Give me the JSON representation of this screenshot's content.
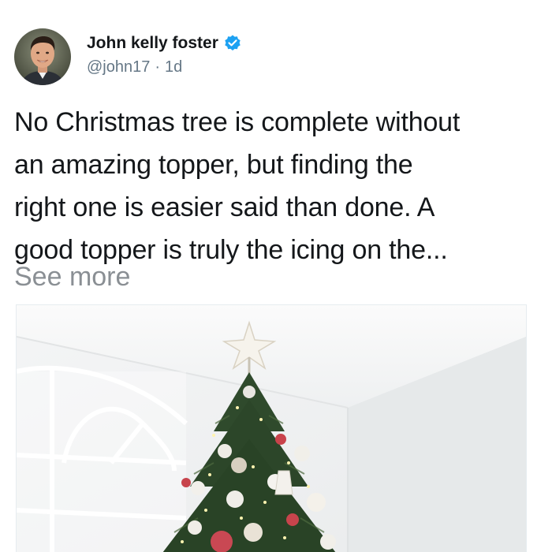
{
  "author": {
    "display_name": "John kelly foster",
    "handle": "@john17",
    "separator": "·",
    "time": "1d",
    "verified_color": "#1da1f2"
  },
  "tweet": {
    "lines": [
      "No Christmas tree is complete without",
      "an amazing topper, but finding the",
      "right one is easier said than done. A",
      "good topper is truly the icing on the..."
    ],
    "see_more": "See more"
  },
  "icons": {
    "verified": "verified-badge-icon",
    "avatar": "profile-photo"
  },
  "colors": {
    "text": "#14171a",
    "secondary": "#657786",
    "see_more": "#8a8f94",
    "accent": "#1da1f2"
  }
}
